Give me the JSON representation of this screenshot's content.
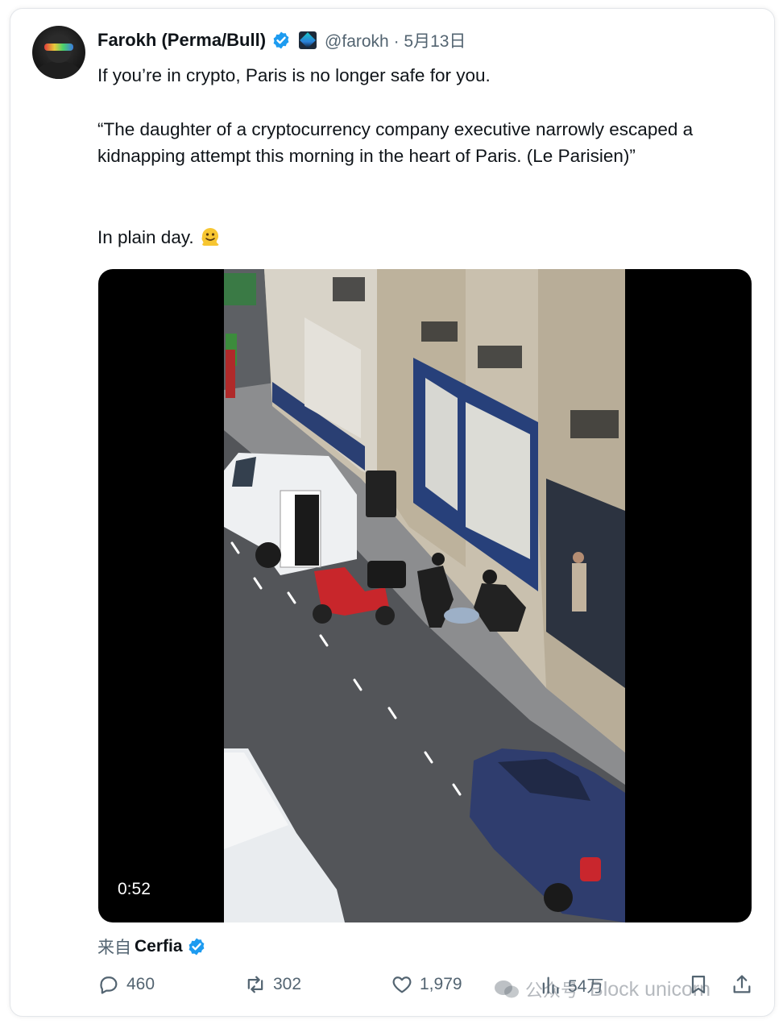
{
  "tweet": {
    "author_name": "Farokh (Perma/Bull)",
    "handle_date": "@farokh · 5月13日",
    "line1": "If you’re in crypto, Paris is no longer safe for you.",
    "quote": "“The daughter of a cryptocurrency company executive narrowly escaped a kidnapping attempt this morning in the heart of Paris. (Le Parisien)”",
    "line3": "In plain day.",
    "emoji": "melting-face"
  },
  "video": {
    "duration": "0:52"
  },
  "source": {
    "prefix": "来自",
    "name": "Cerfia"
  },
  "actions": {
    "replies": "460",
    "reposts": "302",
    "likes": "1,979",
    "views": "54万"
  },
  "watermark": {
    "platform": "公众号",
    "account": "Block unicorn"
  },
  "colors": {
    "text": "#0f1419",
    "secondary": "#536471",
    "verified": "#1d9bf0"
  }
}
